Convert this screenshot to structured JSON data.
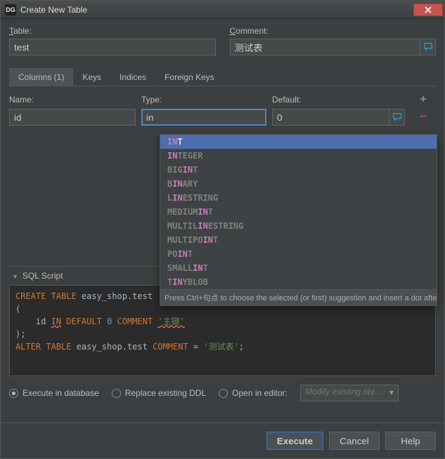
{
  "window": {
    "app_icon": "DG",
    "title": "Create New Table"
  },
  "form": {
    "table_label": "Table:",
    "table_value": "test",
    "comment_label": "Comment:",
    "comment_value": "测试表"
  },
  "tabs": [
    {
      "label": "Columns (1)",
      "active": true
    },
    {
      "label": "Keys",
      "active": false
    },
    {
      "label": "Indices",
      "active": false
    },
    {
      "label": "Foreign Keys",
      "active": false
    }
  ],
  "columns_table": {
    "headers": {
      "name": "Name:",
      "type": "Type:",
      "def": "Default:"
    },
    "row": {
      "name": "id",
      "type": "in",
      "def": "0"
    }
  },
  "autocomplete": {
    "hint": "Press Ctrl+句点 to choose the selected (or first) suggestion and insert a dot afterwards",
    "items": [
      {
        "pre": "",
        "m": "IN",
        "post": "T",
        "sel": true
      },
      {
        "pre": "",
        "m": "IN",
        "post": "TEGER"
      },
      {
        "pre": "BIG",
        "m": "IN",
        "post": "T"
      },
      {
        "pre": "B",
        "m": "IN",
        "post": "ARY"
      },
      {
        "pre": "L",
        "m": "IN",
        "post": "ESTRING"
      },
      {
        "pre": "MEDIUM",
        "m": "IN",
        "post": "T"
      },
      {
        "pre": "MULTIL",
        "m": "IN",
        "post": "ESTRING"
      },
      {
        "pre": "MULTIPO",
        "m": "IN",
        "post": "T"
      },
      {
        "pre": "PO",
        "m": "IN",
        "post": "T"
      },
      {
        "pre": "SMALL",
        "m": "IN",
        "post": "T"
      },
      {
        "pre": "T",
        "m": "IN",
        "post": "YBLOB"
      }
    ]
  },
  "sql": {
    "header": "SQL Script",
    "lines": {
      "l1_kw": "CREATE TABLE",
      "l1_ident": " easy_shop.test",
      "l2": "(",
      "l3_id": "    id ",
      "l3_in": "IN",
      "l3_def": " DEFAULT ",
      "l3_zero": "0",
      "l3_com": " COMMENT ",
      "l3_str": "'主键'",
      "l4": ");",
      "l5_kw": "ALTER TABLE",
      "l5_ident": " easy_shop.test ",
      "l5_com": "COMMENT",
      "l5_eq": " = ",
      "l5_str": "'测试表'",
      "l5_semi": ";"
    }
  },
  "options": {
    "execute": "Execute in database",
    "replace": "Replace existing DDL",
    "open": "Open in editor:",
    "combo": "Modify existing obj…"
  },
  "buttons": {
    "execute": "Execute",
    "cancel": "Cancel",
    "help": "Help"
  }
}
